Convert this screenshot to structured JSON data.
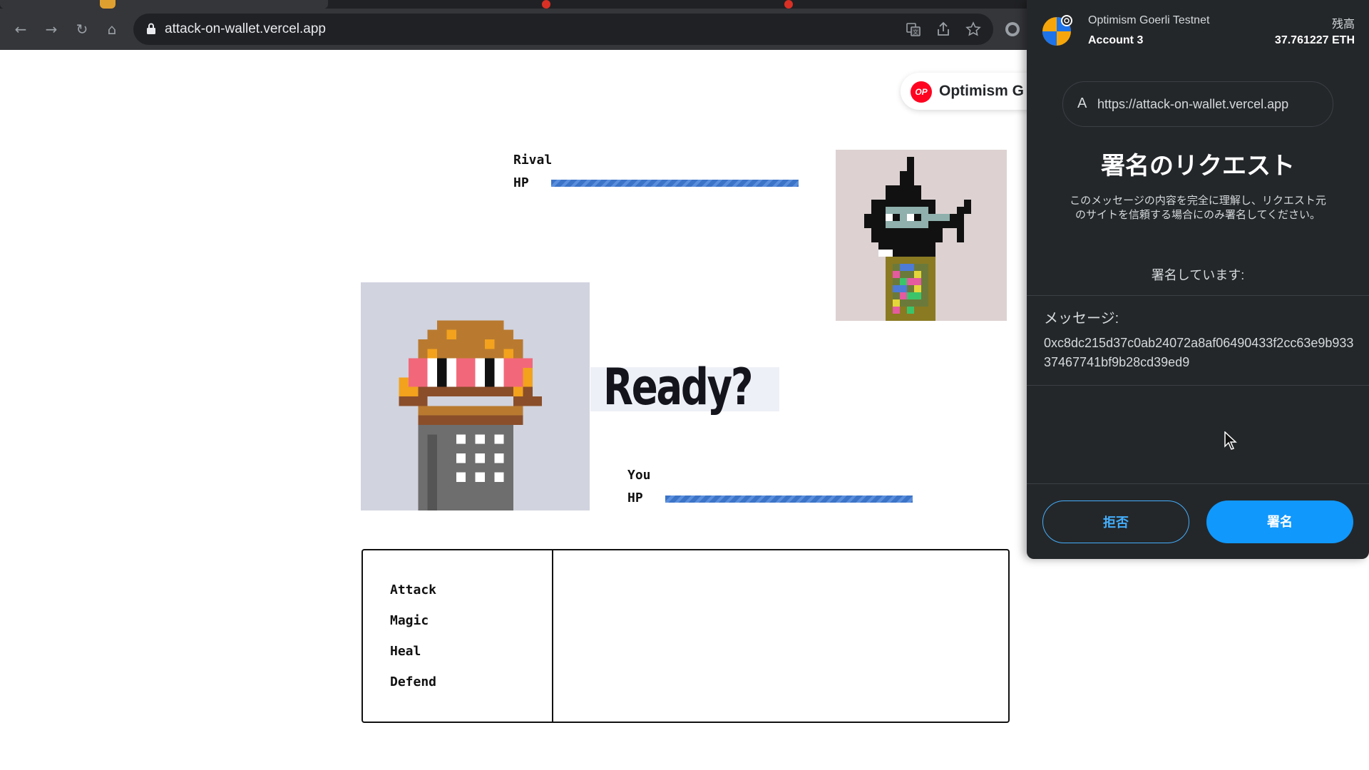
{
  "browser": {
    "url": "attack-on-wallet.vercel.app",
    "icons": [
      "back-icon",
      "forward-icon",
      "reload-icon",
      "home-icon",
      "lock-icon",
      "translate-icon",
      "share-icon",
      "bookmark-star-icon",
      "extension-icon"
    ],
    "nav": {
      "back": "←",
      "forward": "→",
      "reload": "↻",
      "home": "⌂"
    }
  },
  "page": {
    "network_badge": {
      "short": "OP",
      "label": "Optimism G"
    },
    "rival": {
      "name": "Rival",
      "hp_label": "HP",
      "hp_fraction": 1.0
    },
    "you": {
      "name": "You",
      "hp_label": "HP",
      "hp_fraction": 1.0
    },
    "ready_text": "Ready?",
    "commands": [
      "Attack",
      "Magic",
      "Heal",
      "Defend"
    ]
  },
  "metamask": {
    "network": "Optimism Goerli Testnet",
    "account": "Account 3",
    "balance_label": "残高",
    "balance": "37.761227 ETH",
    "origin_initial": "A",
    "origin_url": "https://attack-on-wallet.vercel.app",
    "title": "署名のリクエスト",
    "warning": "このメッセージの内容を完全に理解し、リクエスト元のサイトを信頼する場合にのみ署名してください。",
    "signing_label": "署名しています:",
    "message_label": "メッセージ:",
    "message": "0xc8dc215d37c0ab24072a8af06490433f2cc63e9b93337467741bf9b28cd39ed9",
    "reject_label": "拒否",
    "sign_label": "署名"
  },
  "colors": {
    "hp_bar": "#3c74c8",
    "sign_button": "#1098fc",
    "reject_border": "#43aefc",
    "popup_bg": "#24272a",
    "op_red": "#ff0420"
  }
}
